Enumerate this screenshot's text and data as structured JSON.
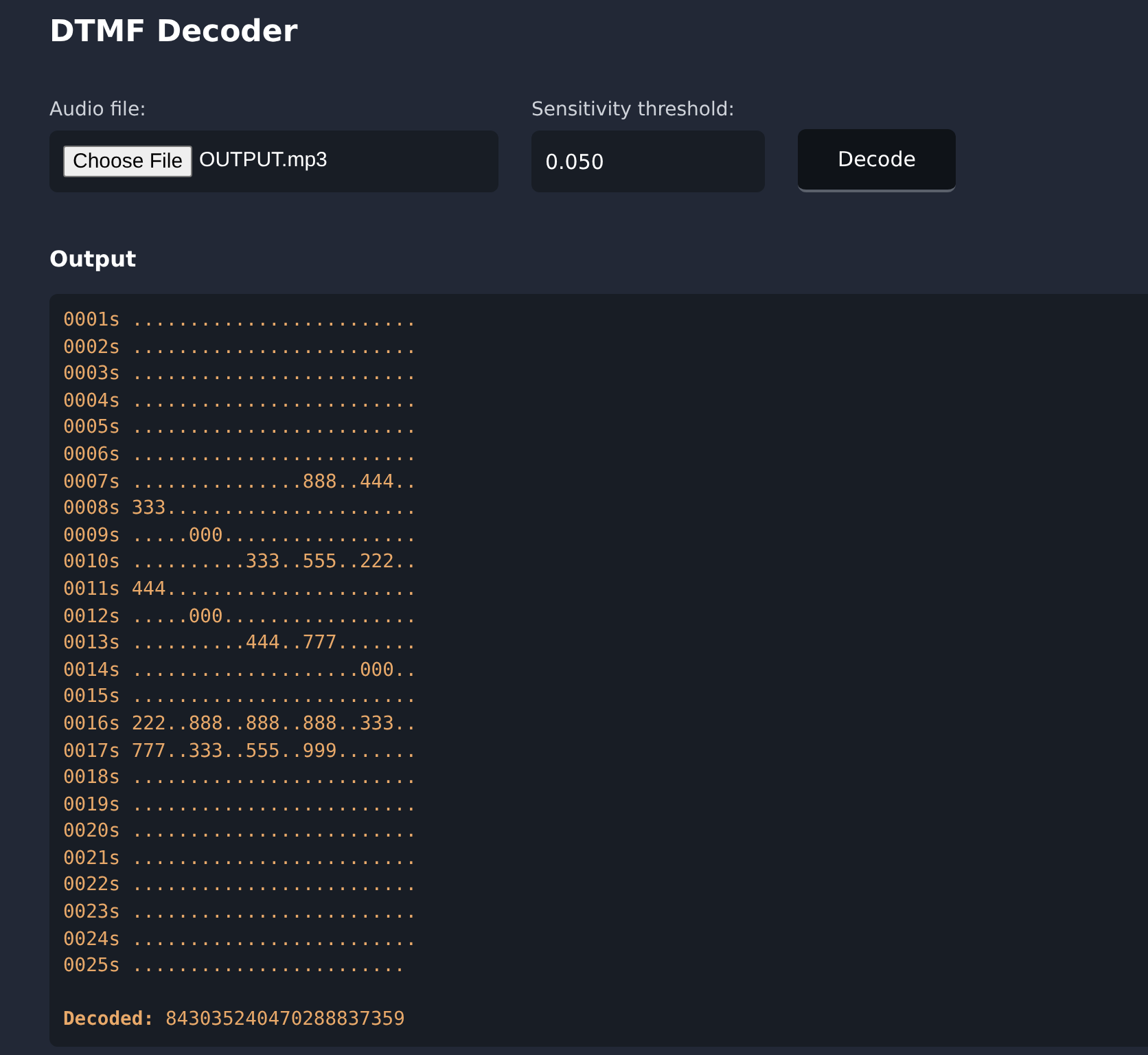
{
  "title": "DTMF Decoder",
  "form": {
    "audio_label": "Audio file:",
    "choose_button": "Choose File",
    "file_name": "OUTPUT.mp3",
    "threshold_label": "Sensitivity threshold:",
    "threshold_value": "0.050",
    "decode_button": "Decode"
  },
  "output": {
    "heading": "Output",
    "lines": [
      "0001s .........................",
      "0002s .........................",
      "0003s .........................",
      "0004s .........................",
      "0005s .........................",
      "0006s .........................",
      "0007s ...............888..444..",
      "0008s 333......................",
      "0009s .....000.................",
      "0010s ..........333..555..222..",
      "0011s 444......................",
      "0012s .....000.................",
      "0013s ..........444..777.......",
      "0014s ....................000..",
      "0015s .........................",
      "0016s 222..888..888..888..333..",
      "0017s 777..333..555..999.......",
      "0018s .........................",
      "0019s .........................",
      "0020s .........................",
      "0021s .........................",
      "0022s .........................",
      "0023s .........................",
      "0024s .........................",
      "0025s ........................"
    ],
    "decoded_label": "Decoded:",
    "decoded_value": "843035240470288837359"
  }
}
